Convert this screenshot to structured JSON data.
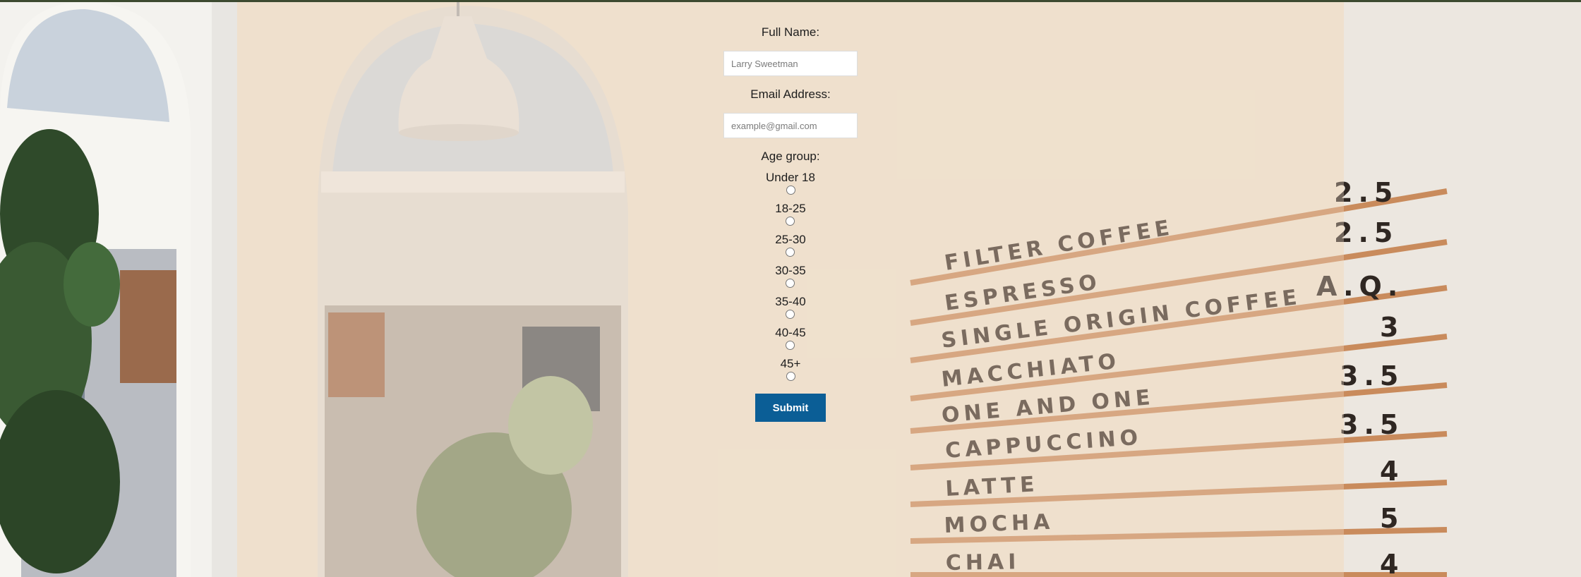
{
  "form": {
    "full_name": {
      "label": "Full Name:",
      "placeholder": "Larry Sweetman"
    },
    "email": {
      "label": "Email Address:",
      "placeholder": "example@gmail.com"
    },
    "age_group": {
      "label": "Age group:",
      "options": [
        "Under 18",
        "18-25",
        "25-30",
        "30-35",
        "35-40",
        "40-45",
        "45+"
      ]
    },
    "submit_label": "Submit"
  },
  "background_menu": {
    "items": [
      "FILTER COFFEE",
      "ESPRESSO",
      "SINGLE ORIGIN COFFEE",
      "MACCHIATO",
      "ONE AND ONE",
      "CAPPUCCINO",
      "LATTE",
      "MOCHA",
      "CHAI"
    ],
    "prices": [
      "2.5",
      "2.5",
      "A.Q.",
      "3",
      "3.5",
      "3.5",
      "4",
      "5",
      "4"
    ]
  },
  "colors": {
    "submit_button": "#0b5e96",
    "top_rule": "#3c4a30",
    "menu_shelf": "#c98b5c"
  }
}
